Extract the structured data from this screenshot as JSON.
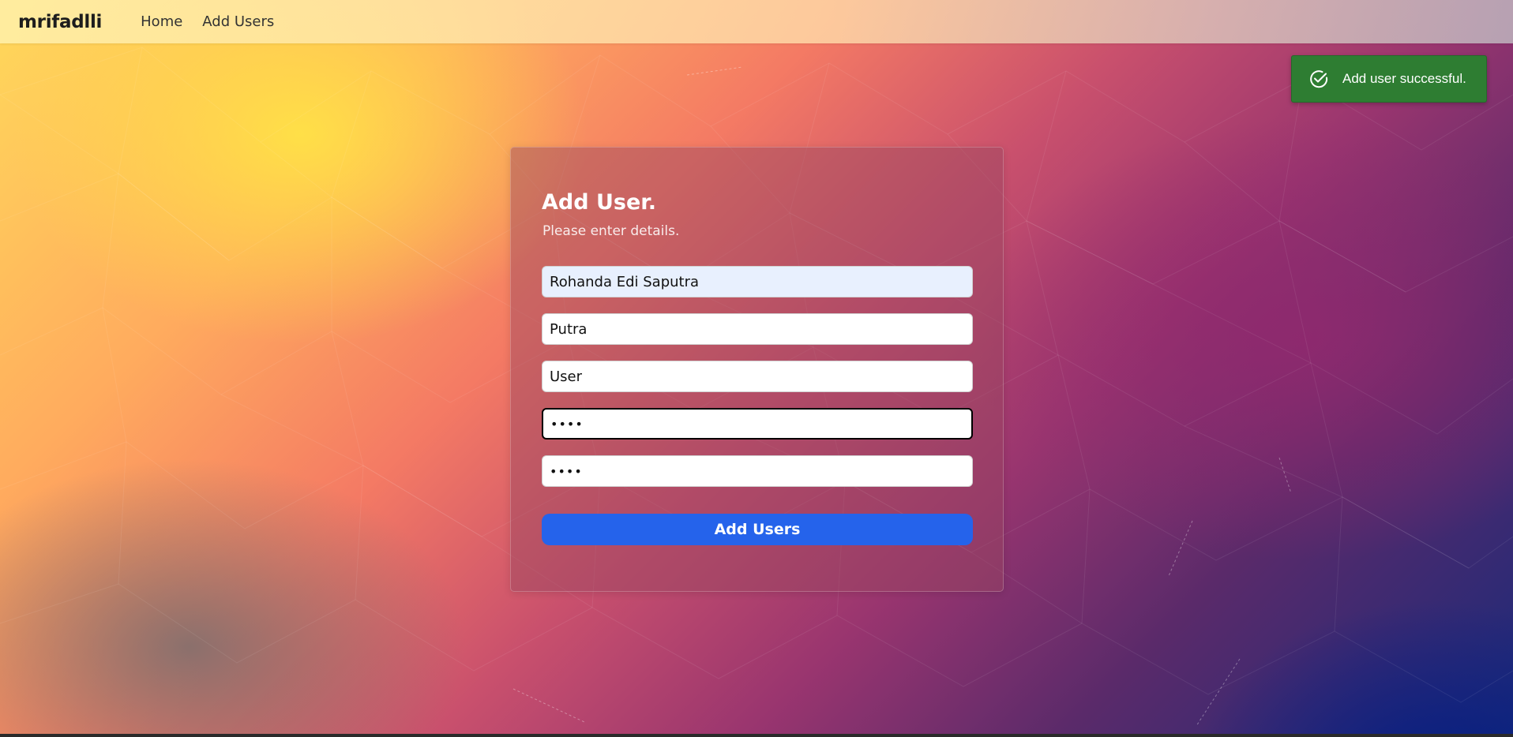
{
  "navbar": {
    "brand": "mrifadlli",
    "links": [
      "Home",
      "Add Users"
    ]
  },
  "toast": {
    "message": "Add user successful.",
    "icon": "check-circle-icon",
    "color": "#2e7d32"
  },
  "form": {
    "title": "Add User.",
    "subtitle": "Please enter details.",
    "fields": {
      "name": "Rohanda Edi Saputra",
      "username": "Putra",
      "role": "User",
      "password": "••••",
      "confirm_password": "••••"
    },
    "submit_label": "Add Users",
    "accent_color": "#2563eb"
  }
}
